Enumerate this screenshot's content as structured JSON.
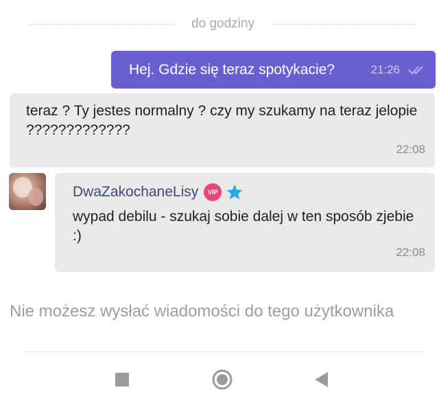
{
  "divider": {
    "label": "do godziny"
  },
  "messages": {
    "outgoing": {
      "text": "Hej. Gdzie się teraz spotykacie?",
      "time": "21:26"
    },
    "incoming_1": {
      "text": "teraz ? Ty jestes normalny ? czy my szukamy na teraz jelopie ?????????????",
      "time": "22:08"
    },
    "incoming_2": {
      "sender": "DwaZakochaneLisy",
      "badge": "VIP",
      "text": "wypad debilu - szukaj sobie dalej w ten sposób zjebie :)",
      "time": "22:08"
    }
  },
  "composer": {
    "notice": "Nie możesz wysłać wiadomości do tego użytkownika"
  },
  "colors": {
    "outgoing_bubble": "#6a5fd0",
    "incoming_bubble": "#e9e9e9",
    "vip_badge": "#e8467d",
    "star": "#29a9e8",
    "sender_name": "#3b4a7e"
  },
  "icons": {
    "read_receipt": "double-check-icon",
    "vip": "vip-badge-icon",
    "star": "star-icon",
    "nav_recents": "square-icon",
    "nav_home": "circle-home-icon",
    "nav_back": "triangle-back-icon"
  }
}
